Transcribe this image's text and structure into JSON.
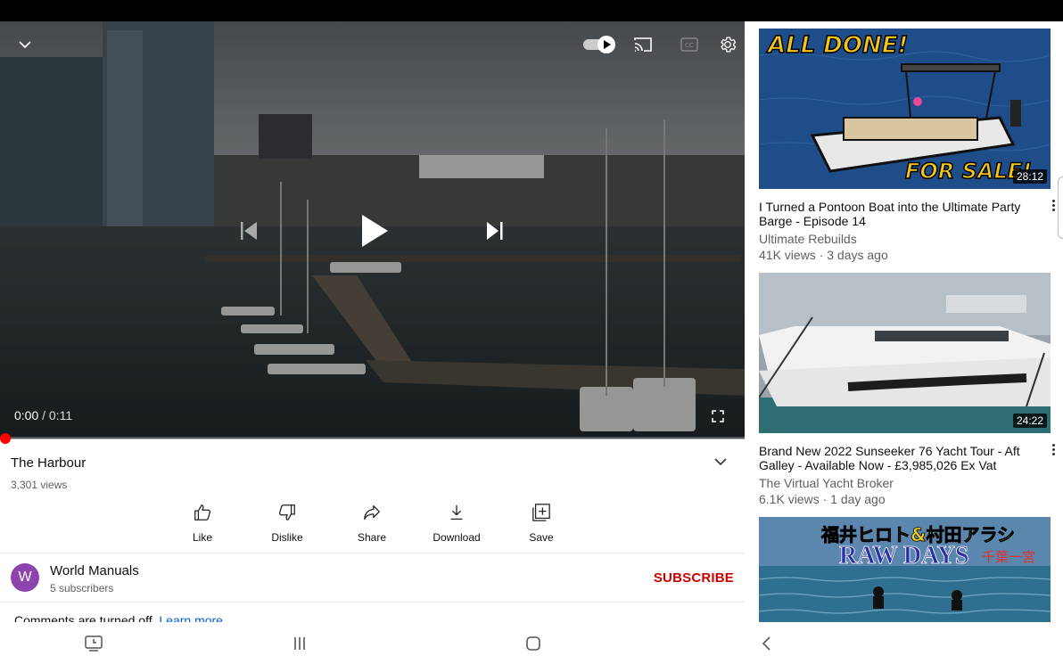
{
  "player": {
    "time_current": "0:00",
    "time_separator": " / ",
    "time_total": "0:11",
    "progress": 0.0
  },
  "video": {
    "title": "The Harbour",
    "views": "3,301 views"
  },
  "actions": [
    {
      "label": "Like",
      "icon": "thumb-up-icon"
    },
    {
      "label": "Dislike",
      "icon": "thumb-down-icon"
    },
    {
      "label": "Share",
      "icon": "share-icon"
    },
    {
      "label": "Download",
      "icon": "download-icon"
    },
    {
      "label": "Save",
      "icon": "playlist-add-icon"
    }
  ],
  "channel": {
    "avatar_letter": "W",
    "name": "World Manuals",
    "subscribers": "5 subscribers",
    "subscribe_label": "SUBSCRIBE"
  },
  "comments": {
    "text": "Comments are turned off.",
    "link": "Learn more"
  },
  "recommended": [
    {
      "thumb_text_top": "ALL DONE!",
      "thumb_text_bottom": "FOR SALE!",
      "duration": "28:12",
      "title": "I Turned a Pontoon Boat into the Ultimate Party Barge - Episode 14",
      "channel": "Ultimate Rebuilds",
      "meta": "41K views · 3 days ago"
    },
    {
      "duration": "24:22",
      "title": "Brand New 2022 Sunseeker 76 Yacht Tour - Aft Galley - Available Now - £3,985,026 Ex Vat",
      "channel": "The Virtual Yacht Broker",
      "meta": "6.1K views · 1 day ago"
    },
    {
      "thumb_text_top": "福井ヒロト&村田アラシ",
      "thumb_text_bottom": "RAW DAYS",
      "thumb_text_side": "千葉一宮"
    }
  ],
  "colors": {
    "subscribe": "#cc0000",
    "link": "#065fd4",
    "progress": "#ff0000",
    "avatar": "#8e44ad"
  }
}
